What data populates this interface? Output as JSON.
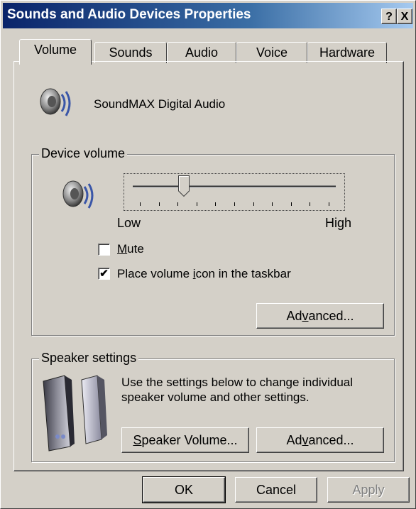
{
  "window": {
    "title": "Sounds and Audio Devices Properties"
  },
  "titlebar_buttons": {
    "help": "?",
    "close": "X"
  },
  "tabs": [
    {
      "label": "Volume",
      "active": true
    },
    {
      "label": "Sounds",
      "active": false
    },
    {
      "label": "Audio",
      "active": false
    },
    {
      "label": "Voice",
      "active": false
    },
    {
      "label": "Hardware",
      "active": false
    }
  ],
  "device": {
    "name": "SoundMAX Digital Audio",
    "icon": "speaker-icon"
  },
  "device_volume": {
    "group_label": "Device volume",
    "low_label": "Low",
    "high_label": "High",
    "level": 0.25,
    "tick_count": 11,
    "mute": {
      "label_pre": "",
      "label_u": "M",
      "label_post": "ute",
      "checked": false
    },
    "taskbar": {
      "label_pre": "Place volume ",
      "label_u": "i",
      "label_post": "con in the taskbar",
      "checked": true
    },
    "advanced": {
      "pre": "Ad",
      "u": "v",
      "post": "anced..."
    }
  },
  "speaker_settings": {
    "group_label": "Speaker settings",
    "line1": "Use the settings below to change individual",
    "line2": "speaker volume and other settings.",
    "speaker_volume": {
      "pre": "",
      "u": "S",
      "post": "peaker Volume..."
    },
    "advanced": {
      "pre": "Ad",
      "u": "v",
      "post": "anced..."
    }
  },
  "footer": {
    "ok": "OK",
    "cancel": "Cancel",
    "apply": "Apply"
  },
  "colors": {
    "title_start": "#0a246a",
    "title_end": "#a6caf0",
    "face": "#d4d0c8"
  }
}
